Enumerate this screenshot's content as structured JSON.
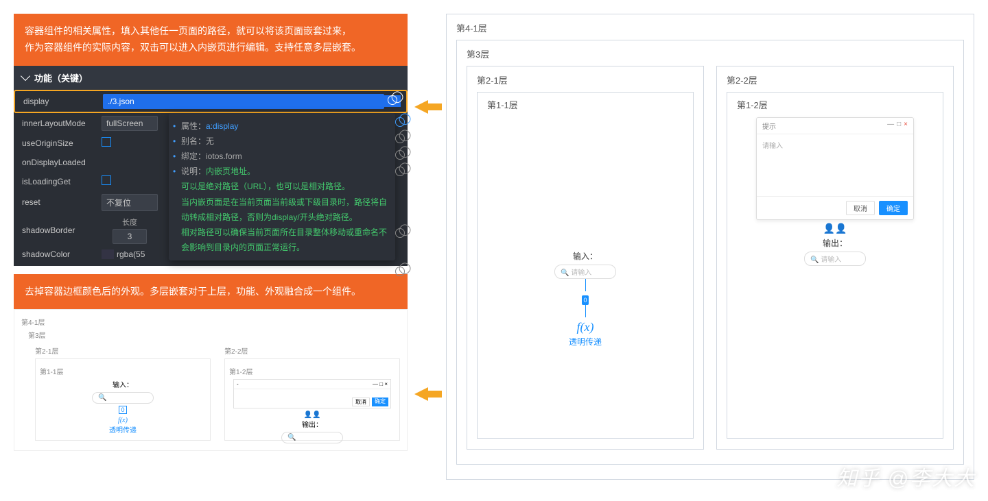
{
  "banner1": {
    "line1": "容器组件的相关属性，填入其他任一页面的路径，就可以将该页面嵌套过来，",
    "line2": "作为容器组件的实际内容，双击可以进入内嵌页进行编辑。支持任意多层嵌套。"
  },
  "banner2": "去掉容器边框颜色后的外观。多层嵌套对于上层，功能、外观融合成一个组件。",
  "section_title": "功能（关键）",
  "props": {
    "display": {
      "label": "display",
      "value": "./3.json"
    },
    "innerLayoutMode": {
      "label": "innerLayoutMode",
      "value": "fullScreen"
    },
    "useOriginSize": {
      "label": "useOriginSize"
    },
    "onDisplayLoaded": {
      "label": "onDisplayLoaded"
    },
    "isLoadingGet": {
      "label": "isLoadingGet"
    },
    "reset": {
      "label": "reset",
      "value": "不复位"
    },
    "shadowBorder": {
      "label": "shadowBorder",
      "len_label": "长度",
      "value": "3"
    },
    "shadowColor": {
      "label": "shadowColor",
      "value": "rgba(55"
    }
  },
  "tooltip": {
    "t_attr": "属性：",
    "v_attr": "a:display",
    "t_alias": "别名：",
    "v_alias": "无",
    "t_bind": "绑定：",
    "v_bind": "iotos.form",
    "t_desc": "说明：",
    "v_desc": "内嵌页地址。",
    "body1": "可以是绝对路径（URL），也可以是相对路径。",
    "body2": "当内嵌页面是在当前页面当前级或下级目录时，路径将自动转成相对路径，否则为display/开头绝对路径。",
    "body3": "相对路径可以确保当前页面所在目录整体移动或重命名不会影响到目录内的页面正常运行。"
  },
  "layers": {
    "l4": "第4-1层",
    "l3": "第3层",
    "l21": "第2-1层",
    "l22": "第2-2层",
    "l11": "第1-1层",
    "l12": "第1-2层"
  },
  "preview": {
    "dialog_title": "提示",
    "dialog_body": "请输入",
    "btn_cancel": "取消",
    "btn_ok": "确定",
    "input_label": "输入：",
    "output_label": "输出：",
    "search_ph": "请输入",
    "pin": "0",
    "fx": "f(x)",
    "fx_label": "透明传递"
  },
  "mini": {
    "l4": "第4-1层",
    "l3": "第3层",
    "l21": "第2-1层",
    "l22": "第2-2层",
    "l11": "第1-1层",
    "l12": "第1-2层",
    "in": "输入：",
    "out": "输出：",
    "fx": "f(x)",
    "fxl": "透明传递",
    "btn_cancel": "取消",
    "btn_ok": "确定"
  },
  "watermark": "知乎 @李大大"
}
